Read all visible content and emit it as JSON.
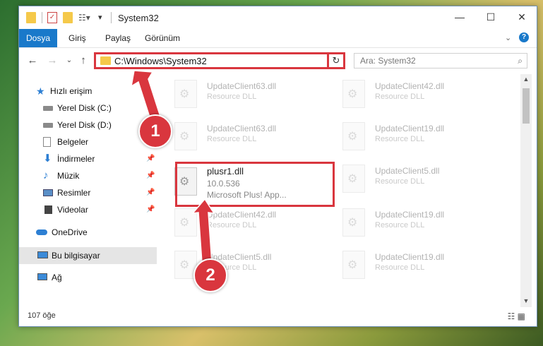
{
  "window": {
    "title": "System32"
  },
  "ribbon": {
    "tabs": [
      {
        "label": "Dosya",
        "active": true
      },
      {
        "label": "Giriş"
      },
      {
        "label": "Paylaş"
      },
      {
        "label": "Görünüm"
      }
    ]
  },
  "address": {
    "path": "C:\\Windows\\System32",
    "search_placeholder": "Ara: System32"
  },
  "sidebar": {
    "items": [
      {
        "label": "Hızlı erişim",
        "icon": "star-icon"
      },
      {
        "label": "Yerel Disk (C:)",
        "icon": "drive-icon"
      },
      {
        "label": "Yerel Disk (D:)",
        "icon": "drive-icon"
      },
      {
        "label": "Belgeler",
        "icon": "documents-icon"
      },
      {
        "label": "İndirmeler",
        "icon": "download-icon"
      },
      {
        "label": "Müzik",
        "icon": "music-icon"
      },
      {
        "label": "Resimler",
        "icon": "pictures-icon"
      },
      {
        "label": "Videolar",
        "icon": "videos-icon"
      },
      {
        "label": "OneDrive",
        "icon": "cloud-icon"
      },
      {
        "label": "Bu bilgisayar",
        "icon": "computer-icon",
        "selected": true
      },
      {
        "label": "Ağ",
        "icon": "network-icon"
      }
    ]
  },
  "files": [
    {
      "name": "UpdateClient63.dll",
      "sub": "Resource DLL"
    },
    {
      "name": "UpdateClient42.dll",
      "sub": "Resource DLL"
    },
    {
      "name": "UpdateClient63.dll",
      "sub": "Resource DLL"
    },
    {
      "name": "UpdateClient19.dll",
      "sub": "Resource DLL"
    },
    {
      "name": "plusr1.dll",
      "sub": "10.0.536",
      "sub2": "Microsoft Plus! App..."
    },
    {
      "name": "UpdateClient5.dll",
      "sub": "Resource DLL"
    },
    {
      "name": "UpdateClient42.dll",
      "sub": "Resource DLL"
    },
    {
      "name": "UpdateClient19.dll",
      "sub": "Resource DLL"
    },
    {
      "name": "UpdateClient5.dll",
      "sub": "Resource DLL"
    },
    {
      "name": "UpdateClient19.dll",
      "sub": "Resource DLL"
    }
  ],
  "status": {
    "count": "107 öğe"
  },
  "callouts": [
    "1",
    "2"
  ]
}
